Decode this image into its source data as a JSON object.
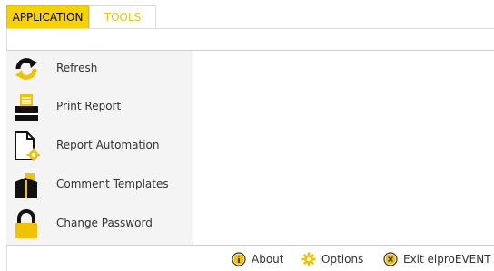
{
  "tabs": [
    {
      "label": "APPLICATION",
      "active": true
    },
    {
      "label": "TOOLS",
      "active": false
    }
  ],
  "menu": [
    {
      "label": "Refresh",
      "icon": "refresh-icon"
    },
    {
      "label": "Print Report",
      "icon": "printer-icon"
    },
    {
      "label": "Report Automation",
      "icon": "report-automation-icon"
    },
    {
      "label": "Comment Templates",
      "icon": "comment-templates-icon"
    },
    {
      "label": "Change Password",
      "icon": "lock-icon"
    }
  ],
  "status": {
    "about_label": "About",
    "options_label": "Options",
    "exit_label": "Exit elproEVENT"
  },
  "colors": {
    "accent": "#f6d300",
    "tools_tab_text": "#f0c400"
  }
}
